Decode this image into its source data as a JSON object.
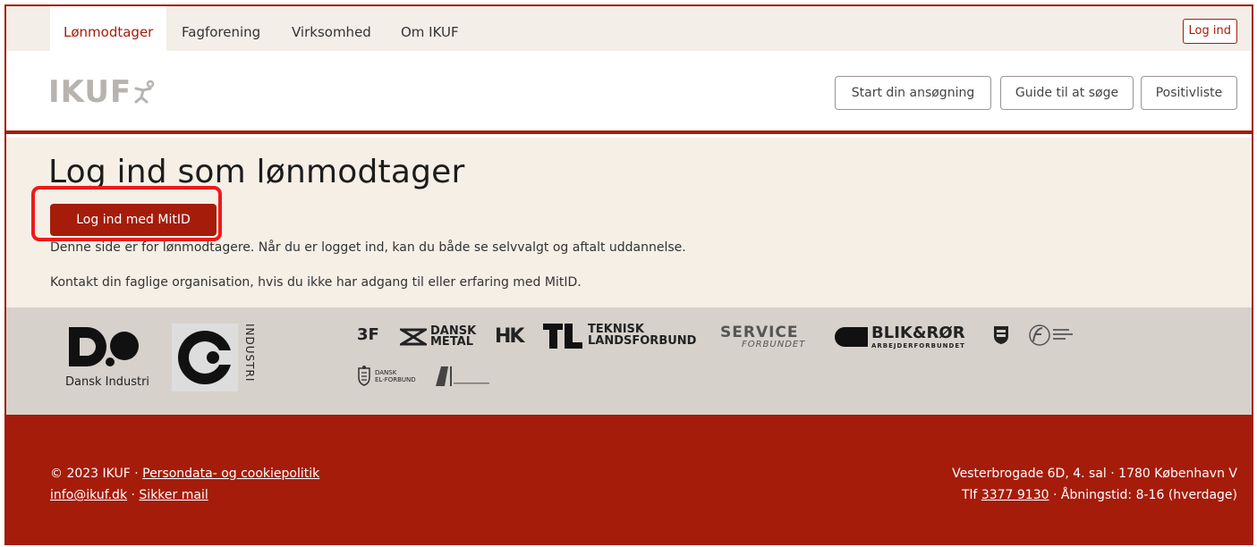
{
  "topnav": {
    "tabs": [
      {
        "label": "Lønmodtager"
      },
      {
        "label": "Fagforening"
      },
      {
        "label": "Virksomhed"
      },
      {
        "label": "Om IKUF"
      }
    ],
    "login_label": "Log ind"
  },
  "header": {
    "logo_text": "IKUF",
    "buttons": [
      {
        "label": "Start din ansøgning"
      },
      {
        "label": "Guide til at søge"
      },
      {
        "label": "Positivliste"
      }
    ]
  },
  "main": {
    "title": "Log ind som lønmodtager",
    "mitid_button": "Log ind med MitID",
    "paragraph1": "Denne side er for lønmodtagere. Når du er logget ind, kan du både se selvvalgt og aftalt uddannelse.",
    "paragraph2": "Kontakt din faglige organisation, hvis du ikke har adgang til eller erfaring med MitID."
  },
  "partners": {
    "dansk_industri": "Dansk Industri",
    "co_industri": "INDUSTRI",
    "threef": "3F",
    "dansk_metal": [
      "DANSK",
      "METAL"
    ],
    "hk": "HK",
    "teknisk": [
      "TEKNISK",
      "LANDSFORBUND"
    ],
    "service": [
      "SERVICE",
      "FORBUNDET"
    ],
    "blik": [
      "BLIK&RØR",
      "ARBEJDERFORBUNDET"
    ],
    "el": [
      "DANSK",
      "EL-FORBUND"
    ]
  },
  "footer": {
    "copyright": "© 2023 IKUF ·",
    "privacy_link": "Persondata- og cookiepolitik",
    "email_link": "info@ikuf.dk",
    "sep": "·",
    "secure_mail_link": "Sikker mail",
    "address": "Vesterbrogade 6D, 4. sal · 1780 København V",
    "phone_prefix": "Tlf",
    "phone_link": "3377 9130",
    "hours": "· Åbningstid: 8-16 (hverdage)"
  },
  "colors": {
    "brand": "#a51c0a",
    "main_bg": "#f5efe6",
    "partners_bg": "#d6d1cb",
    "highlight": "#ee1a1a"
  }
}
